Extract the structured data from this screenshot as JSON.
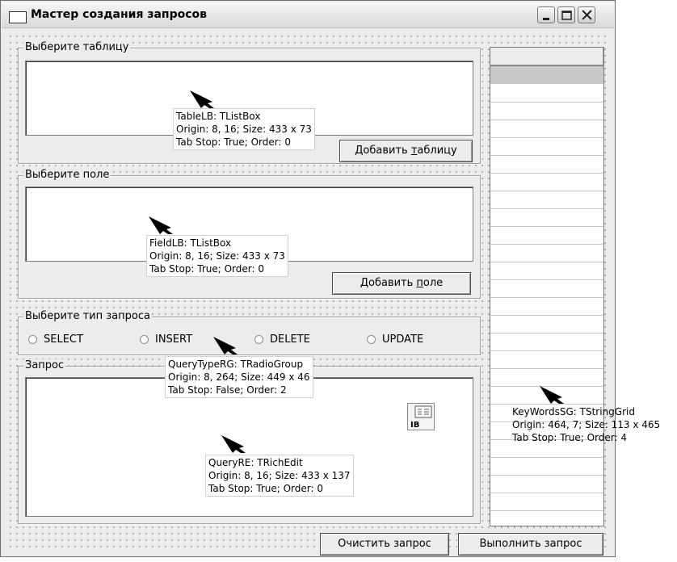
{
  "window": {
    "title": "Мастер создания запросов"
  },
  "table_group": {
    "label": "Выберите таблицу",
    "add_button": "Добавить таблицу",
    "add_button_accel": "т"
  },
  "field_group": {
    "label": "Выберите поле",
    "add_button": "Добавить поле",
    "add_button_accel": "п"
  },
  "query_type_group": {
    "label": "Выберите тип запроса",
    "options": [
      "SELECT",
      "INSERT",
      "DELETE",
      "UPDATE"
    ]
  },
  "query_group": {
    "label": "Запрос"
  },
  "buttons": {
    "clear": "Очистить запрос",
    "execute": "Выполнить запрос"
  },
  "hints": {
    "table_lb": [
      "TableLB: TListBox",
      "Origin: 8, 16; Size: 433 x 73",
      "Tab Stop: True; Order: 0"
    ],
    "field_lb": [
      "FieldLB: TListBox",
      "Origin: 8, 16; Size: 433 x 73",
      "Tab Stop: True; Order: 0"
    ],
    "query_type_rg": [
      "QueryTypeRG: TRadioGroup",
      "Origin: 8, 264; Size: 449 x 46",
      "Tab Stop: False; Order: 2"
    ],
    "query_re": [
      "QueryRE: TRichEdit",
      "Origin: 8, 16; Size: 433 x 137",
      "Tab Stop: True; Order: 0"
    ],
    "keywords_sg": [
      "KeyWordsSG: TStringGrid",
      "Origin: 464, 7; Size: 113 x 465",
      "Tab Stop: True; Order: 4"
    ]
  },
  "icons": {
    "ib_component": "IB"
  }
}
